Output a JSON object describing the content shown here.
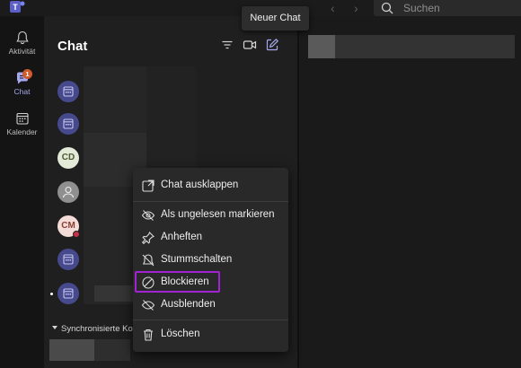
{
  "topbar": {
    "search_placeholder": "Suchen",
    "back_arrow": "‹",
    "forward_arrow": "›",
    "app_icon": "teams-logo-icon"
  },
  "rail": {
    "items": [
      {
        "label": "Aktivität",
        "icon": "bell-icon",
        "active": false
      },
      {
        "label": "Chat",
        "icon": "chat-icon",
        "active": true,
        "badge": "1"
      },
      {
        "label": "Kalender",
        "icon": "calendar-icon",
        "active": false
      }
    ]
  },
  "chat_panel": {
    "title": "Chat",
    "filter_icon": "filter-icon",
    "video_icon": "video-call-icon",
    "new_chat_icon": "new-chat-icon",
    "avatars": [
      {
        "type": "calendar"
      },
      {
        "type": "calendar"
      },
      {
        "type": "initials",
        "initials": "CD"
      },
      {
        "type": "person"
      },
      {
        "type": "initials",
        "initials": "CM",
        "presence": "busy"
      },
      {
        "type": "calendar"
      },
      {
        "type": "calendar",
        "unread": true
      }
    ],
    "section_header": "Synchronisierte Kontakte"
  },
  "tooltip": {
    "text": "Neuer Chat"
  },
  "context_menu": {
    "items": [
      {
        "label": "Chat ausklappen",
        "icon": "pop-out-icon"
      },
      {
        "label": "Als ungelesen markieren",
        "icon": "mark-unread-icon"
      },
      {
        "label": "Anheften",
        "icon": "pin-icon"
      },
      {
        "label": "Stummschalten",
        "icon": "mute-icon"
      },
      {
        "label": "Blockieren",
        "icon": "block-icon",
        "highlighted": true
      },
      {
        "label": "Ausblenden",
        "icon": "hide-icon"
      },
      {
        "label": "Löschen",
        "icon": "trash-icon"
      }
    ]
  },
  "colors": {
    "highlight_border": "#a223d1",
    "accent": "#a7a9f0",
    "badge": "#d05a2c"
  }
}
